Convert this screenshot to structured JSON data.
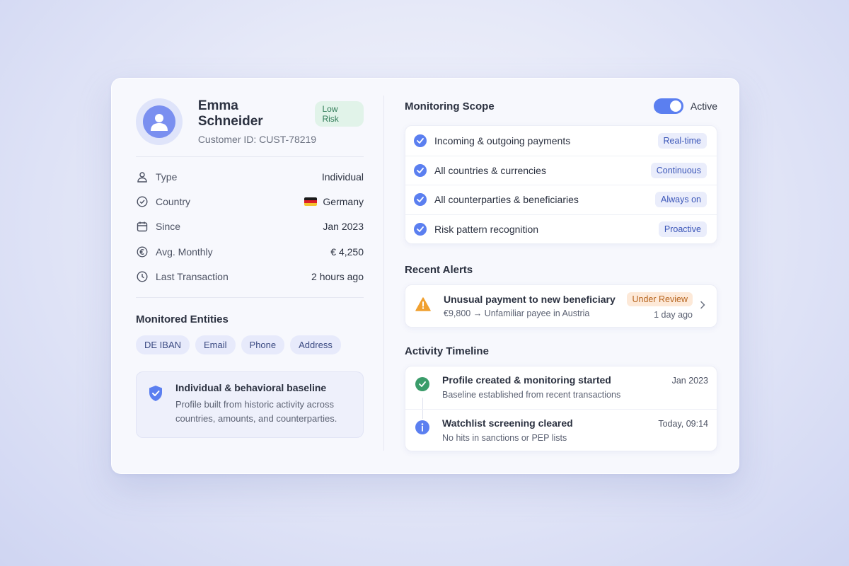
{
  "profile": {
    "name": "Emma Schneider",
    "risk_badge": "Low Risk",
    "customer_id": "Customer ID: CUST-78219",
    "avatar_icon": "user-avatar-icon"
  },
  "details": [
    {
      "icon": "user-icon",
      "label": "Type",
      "value": "Individual"
    },
    {
      "icon": "check-circle-icon",
      "label": "Country",
      "value": "Germany",
      "flag": "de-flag-icon"
    },
    {
      "icon": "calendar-icon",
      "label": "Since",
      "value": "Jan 2023"
    },
    {
      "icon": "euro-icon",
      "label": "Avg. Monthly",
      "value": "€ 4,250"
    },
    {
      "icon": "clock-icon",
      "label": "Last Transaction",
      "value": "2 hours ago"
    }
  ],
  "entities": {
    "title": "Monitored Entities",
    "chips": [
      "DE IBAN",
      "Email",
      "Phone",
      "Address"
    ]
  },
  "baseline": {
    "icon": "shield-check-icon",
    "title": "Individual & behavioral baseline",
    "description": "Profile built from historic activity across countries, amounts, and counterparties."
  },
  "monitoring": {
    "title": "Monitoring Scope",
    "toggle_label": "Active",
    "toggle_on": true,
    "items": [
      {
        "label": "Incoming & outgoing payments",
        "tag": "Real-time"
      },
      {
        "label": "All countries & currencies",
        "tag": "Continuous"
      },
      {
        "label": "All counterparties & beneficiaries",
        "tag": "Always on"
      },
      {
        "label": "Risk pattern recognition",
        "tag": "Proactive"
      }
    ]
  },
  "alerts": {
    "title": "Recent Alerts",
    "items": [
      {
        "icon": "warning-triangle-icon",
        "title": "Unusual payment to new beneficiary",
        "description": "€9,800 → Unfamiliar payee in Austria",
        "status": "Under Review",
        "time": "1 day ago"
      }
    ]
  },
  "timeline": {
    "title": "Activity Timeline",
    "items": [
      {
        "icon": "check-circle-icon",
        "title": "Profile created & monitoring started",
        "description": "Baseline established from recent transactions",
        "time": "Jan 2023"
      },
      {
        "icon": "info-icon",
        "title": "Watchlist screening cleared",
        "description": "No hits in sanctions or PEP lists",
        "time": "Today, 09:14"
      }
    ]
  },
  "colors": {
    "accent": "#5b7ff0",
    "success": "#3a9c6a",
    "warning": "#f0a030"
  }
}
